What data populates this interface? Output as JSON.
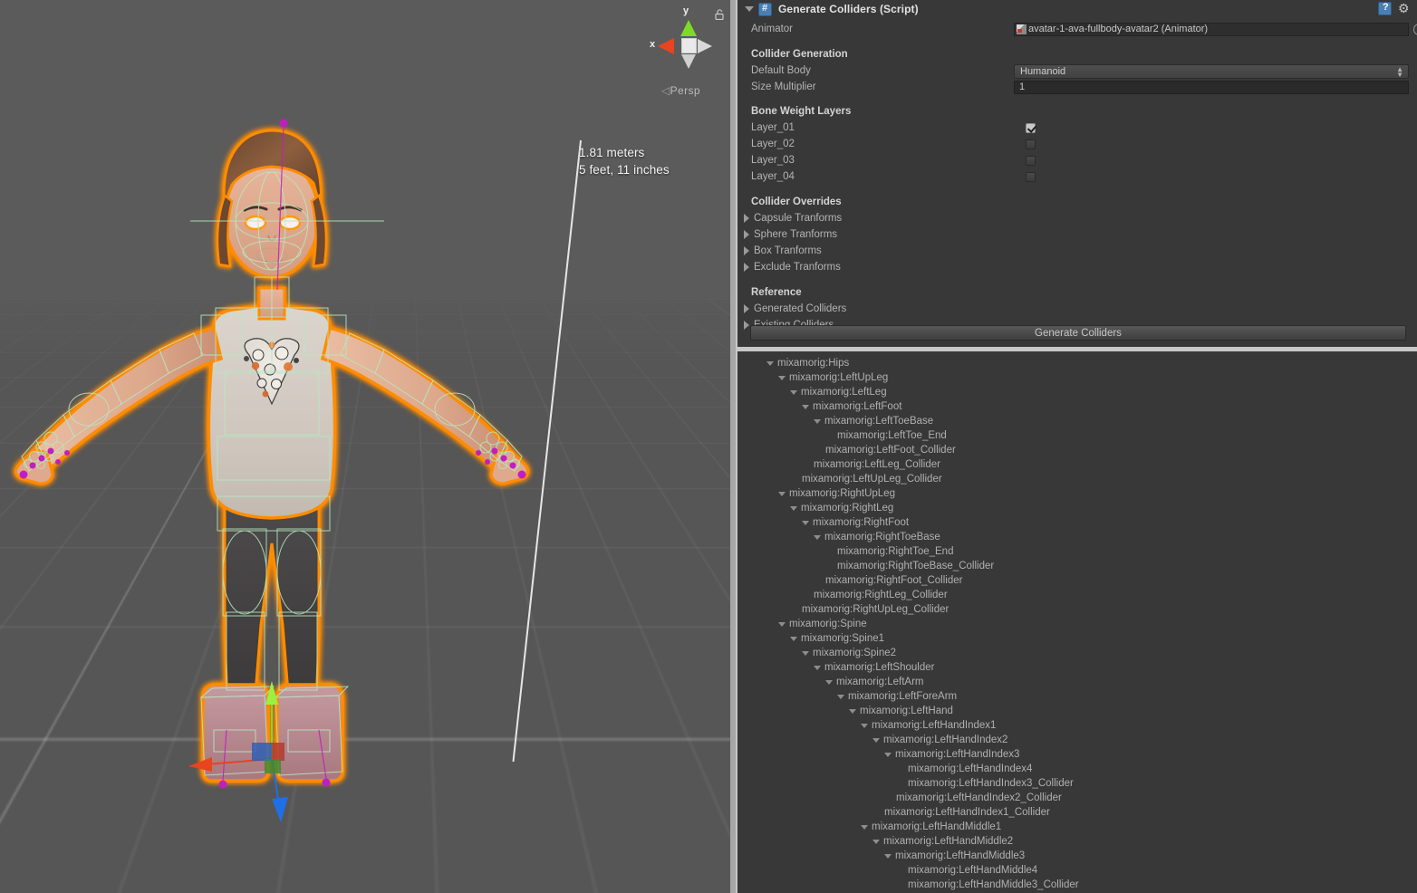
{
  "viewport": {
    "measurement": {
      "meters": "1.81 meters",
      "imperial": "5 feet, 11 inches"
    },
    "gizmo": {
      "x_label": "x",
      "y_label": "y",
      "mode": "Persp",
      "mode_chevron": "◁",
      "lock_icon": "lock-open-icon"
    },
    "scene_description": "3D humanoid avatar in T-pose with orange selection outline and green collider wireframes"
  },
  "inspector": {
    "component_title": "Generate Colliders (Script)",
    "icon": "script-icon",
    "help_icon": "help-icon",
    "gear_icon": "gear-icon",
    "animator_label": "Animator",
    "animator_value": "avatar-1-ava-fullbody-avatar2 (Animator)",
    "sections": {
      "collider_generation": "Collider Generation",
      "bone_weight_layers": "Bone Weight Layers",
      "collider_overrides": "Collider Overrides",
      "reference": "Reference"
    },
    "default_body_label": "Default Body",
    "default_body_value": "Humanoid",
    "size_multiplier_label": "Size Multiplier",
    "size_multiplier_value": "1",
    "layers": [
      {
        "label": "Layer_01",
        "checked": true
      },
      {
        "label": "Layer_02",
        "checked": false
      },
      {
        "label": "Layer_03",
        "checked": false
      },
      {
        "label": "Layer_04",
        "checked": false
      }
    ],
    "overrides": [
      "Capsule Tranforms",
      "Sphere Tranforms",
      "Box Tranforms",
      "Exclude Tranforms"
    ],
    "reference_items": [
      "Generated Colliders",
      "Existing Colliders"
    ],
    "generate_button": "Generate Colliders"
  },
  "hierarchy": {
    "nodes": [
      {
        "label": "mixamorig:Hips",
        "depth": 1,
        "expandable": true
      },
      {
        "label": "mixamorig:LeftUpLeg",
        "depth": 2,
        "expandable": true
      },
      {
        "label": "mixamorig:LeftLeg",
        "depth": 3,
        "expandable": true
      },
      {
        "label": "mixamorig:LeftFoot",
        "depth": 4,
        "expandable": true
      },
      {
        "label": "mixamorig:LeftToeBase",
        "depth": 5,
        "expandable": true
      },
      {
        "label": "mixamorig:LeftToe_End",
        "depth": 6,
        "expandable": false
      },
      {
        "label": "mixamorig:LeftFoot_Collider",
        "depth": 5,
        "expandable": false
      },
      {
        "label": "mixamorig:LeftLeg_Collider",
        "depth": 4,
        "expandable": false
      },
      {
        "label": "mixamorig:LeftUpLeg_Collider",
        "depth": 3,
        "expandable": false
      },
      {
        "label": "mixamorig:RightUpLeg",
        "depth": 2,
        "expandable": true
      },
      {
        "label": "mixamorig:RightLeg",
        "depth": 3,
        "expandable": true
      },
      {
        "label": "mixamorig:RightFoot",
        "depth": 4,
        "expandable": true
      },
      {
        "label": "mixamorig:RightToeBase",
        "depth": 5,
        "expandable": true
      },
      {
        "label": "mixamorig:RightToe_End",
        "depth": 6,
        "expandable": false
      },
      {
        "label": "mixamorig:RightToeBase_Collider",
        "depth": 6,
        "expandable": false
      },
      {
        "label": "mixamorig:RightFoot_Collider",
        "depth": 5,
        "expandable": false
      },
      {
        "label": "mixamorig:RightLeg_Collider",
        "depth": 4,
        "expandable": false
      },
      {
        "label": "mixamorig:RightUpLeg_Collider",
        "depth": 3,
        "expandable": false
      },
      {
        "label": "mixamorig:Spine",
        "depth": 2,
        "expandable": true
      },
      {
        "label": "mixamorig:Spine1",
        "depth": 3,
        "expandable": true
      },
      {
        "label": "mixamorig:Spine2",
        "depth": 4,
        "expandable": true
      },
      {
        "label": "mixamorig:LeftShoulder",
        "depth": 5,
        "expandable": true
      },
      {
        "label": "mixamorig:LeftArm",
        "depth": 6,
        "expandable": true
      },
      {
        "label": "mixamorig:LeftForeArm",
        "depth": 7,
        "expandable": true
      },
      {
        "label": "mixamorig:LeftHand",
        "depth": 8,
        "expandable": true
      },
      {
        "label": "mixamorig:LeftHandIndex1",
        "depth": 9,
        "expandable": true
      },
      {
        "label": "mixamorig:LeftHandIndex2",
        "depth": 10,
        "expandable": true
      },
      {
        "label": "mixamorig:LeftHandIndex3",
        "depth": 11,
        "expandable": true
      },
      {
        "label": "mixamorig:LeftHandIndex4",
        "depth": 12,
        "expandable": false
      },
      {
        "label": "mixamorig:LeftHandIndex3_Collider",
        "depth": 12,
        "expandable": false
      },
      {
        "label": "mixamorig:LeftHandIndex2_Collider",
        "depth": 11,
        "expandable": false
      },
      {
        "label": "mixamorig:LeftHandIndex1_Collider",
        "depth": 10,
        "expandable": false
      },
      {
        "label": "mixamorig:LeftHandMiddle1",
        "depth": 9,
        "expandable": true
      },
      {
        "label": "mixamorig:LeftHandMiddle2",
        "depth": 10,
        "expandable": true
      },
      {
        "label": "mixamorig:LeftHandMiddle3",
        "depth": 11,
        "expandable": true
      },
      {
        "label": "mixamorig:LeftHandMiddle4",
        "depth": 12,
        "expandable": false
      },
      {
        "label": "mixamorig:LeftHandMiddle3_Collider",
        "depth": 12,
        "expandable": false
      }
    ]
  },
  "colors": {
    "panel_bg": "#383838",
    "viewport_bg": "#5b5b5b",
    "selection_outline": "#ff8c00",
    "collider_wire": "#b8e6c0",
    "axis_x": "#e8441f",
    "axis_y": "#7ddb25",
    "axis_z": "#1f6fe8",
    "bone_pin": "#c01fc0",
    "divider": "#c8c8c8"
  }
}
